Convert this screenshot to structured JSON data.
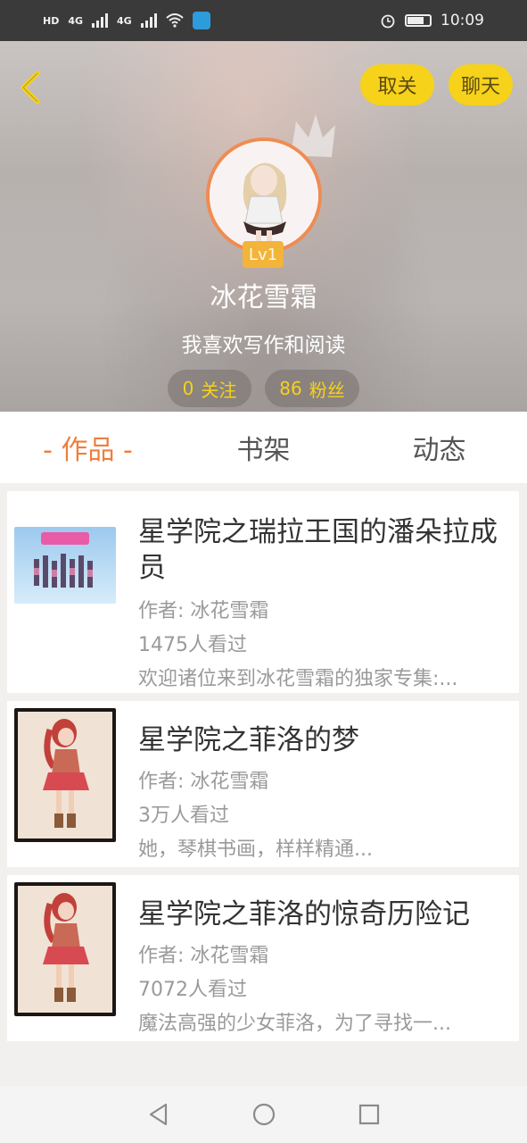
{
  "status_bar": {
    "left_labels": [
      "HD",
      "4G",
      "4G"
    ],
    "time": "10:09"
  },
  "header": {
    "unfollow_label": "取关",
    "chat_label": "聊天",
    "level": "Lv1",
    "name": "冰花雪霜",
    "bio": "我喜欢写作和阅读",
    "following_count": "0",
    "following_label": "关注",
    "fans_count": "86",
    "fans_label": "粉丝"
  },
  "tabs": [
    {
      "label": "- 作品 -",
      "active": true
    },
    {
      "label": "书架",
      "active": false
    },
    {
      "label": "动态",
      "active": false
    }
  ],
  "works": [
    {
      "title": "星学院之瑞拉王国的潘朵拉成员",
      "author": "作者: 冰花雪霜",
      "views": "1475人看过",
      "desc": "欢迎诸位来到冰花雪霜的独家专集:..."
    },
    {
      "title": "星学院之菲洛的梦",
      "author": "作者: 冰花雪霜",
      "views": "3万人看过",
      "desc": "她，琴棋书画，样样精通..."
    },
    {
      "title": "星学院之菲洛的惊奇历险记",
      "author": "作者: 冰花雪霜",
      "views": "7072人看过",
      "desc": "魔法高强的少女菲洛，为了寻找一..."
    }
  ],
  "colors": {
    "accent": "#ef7e3d",
    "button_yellow": "#f6d21a",
    "stat_text": "#f6d21a"
  },
  "icons": {
    "back": "chevron-left-icon",
    "nav_back": "triangle-back-icon",
    "nav_home": "circle-home-icon",
    "nav_recent": "square-recent-icon"
  }
}
